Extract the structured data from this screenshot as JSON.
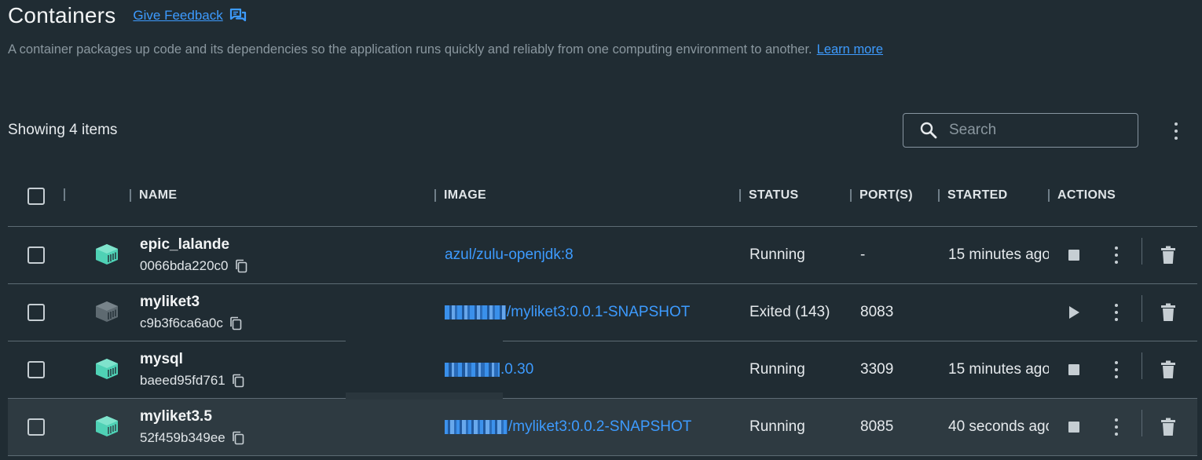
{
  "header": {
    "title": "Containers",
    "feedback_label": "Give Feedback",
    "description": "A container packages up code and its dependencies so the application runs quickly and reliably from one computing environment to another.",
    "learn_more": "Learn more"
  },
  "toolbar": {
    "showing": "Showing 4 items",
    "search_placeholder": "Search"
  },
  "columns": {
    "name": "NAME",
    "image": "IMAGE",
    "status": "STATUS",
    "ports": "PORT(S)",
    "started": "STARTED",
    "actions": "ACTIONS"
  },
  "colors": {
    "running_icon": "#4fd1b5",
    "stopped_icon": "#5e6a71",
    "link": "#3d9bff"
  },
  "rows": [
    {
      "name": "epic_lalande",
      "id": "0066bda220c0",
      "image": "azul/zulu-openjdk:8",
      "status": "Running",
      "ports": "-",
      "started": "15 minutes ago",
      "action": "stop-icon"
    },
    {
      "name": "myliket3",
      "id": "c9b3f6ca6a0c",
      "image": "/myliket3:0.0.1-SNAPSHOT",
      "status": "Exited (143)",
      "ports": "8083",
      "started": "",
      "action": "play-icon"
    },
    {
      "name": "mysql",
      "id": "baeed95fd761",
      "image": ".0.30",
      "status": "Running",
      "ports": "3309",
      "started": "15 minutes ago",
      "action": "stop-icon"
    },
    {
      "name": "myliket3.5",
      "id": "52f459b349ee",
      "image": "/myliket3:0.0.2-SNAPSHOT",
      "status": "Running",
      "ports": "8085",
      "started": "40 seconds ago",
      "action": "stop-icon"
    }
  ]
}
